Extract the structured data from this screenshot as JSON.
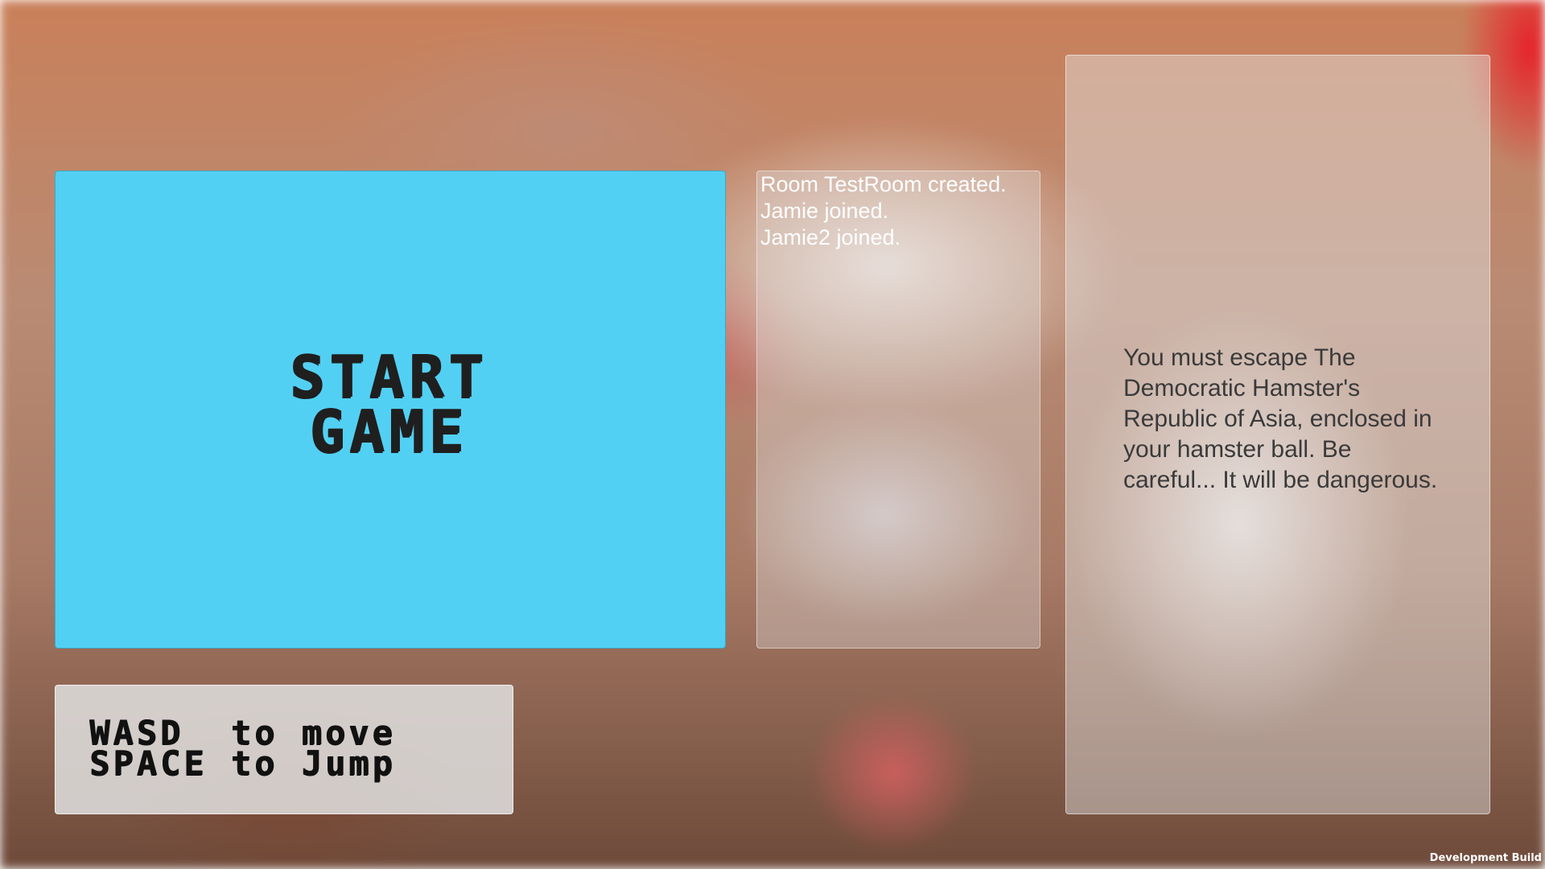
{
  "start_button": {
    "label": "START\nGAME",
    "color": "#52d0f3"
  },
  "event_log": {
    "lines": [
      "Room TestRoom created.",
      "Jamie joined.",
      "Jamie2 joined."
    ]
  },
  "story": {
    "text": "You must escape The Democratic Hamster's Republic of Asia, enclosed in your hamster ball. Be careful... It will be dangerous."
  },
  "controls": {
    "text": "WASD  to move\nSPACE to Jump"
  },
  "build_label": "Development Build"
}
